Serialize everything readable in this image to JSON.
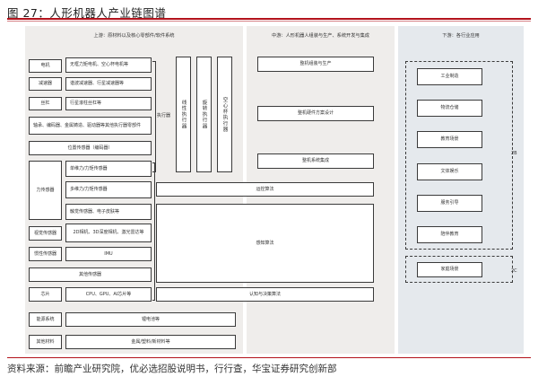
{
  "title": "图 27：人形机器人产业链图谱",
  "upstream": {
    "title": "上游：原材料以及核心零部件/软件系统",
    "rows": [
      {
        "category": "电机",
        "items": "无框力矩电机、空心杯电机等"
      },
      {
        "category": "减速器",
        "items": "谐波减速器、行星减速器等"
      },
      {
        "category": "丝杠",
        "items": "行星滚柱丝杠等"
      },
      {
        "category": "",
        "items": "轴承、编码器、金属铸造、驱动器等其他执行器零部件"
      },
      {
        "category": "",
        "items": "位置传感器（编码器）"
      }
    ],
    "sensor_rows": [
      {
        "category": "力传感器",
        "items": [
          "单维力/力矩传感器",
          "多维力/力矩传感器",
          "触觉传感器、电子皮肤等"
        ]
      },
      {
        "category": "视觉传感器",
        "items": [
          "2D相机、3D深度相机、激光雷达等"
        ]
      },
      {
        "category": "惯性传感器",
        "items": [
          "IMU"
        ]
      }
    ],
    "other_sensors": "其他传感器",
    "chip": {
      "category": "芯片",
      "items": "CPU、GPU、AI芯片等"
    },
    "energy": {
      "category": "能源系统",
      "items": "锂电池等"
    },
    "material": {
      "category": "其他材料",
      "items": "金属/塑料/新材料等"
    },
    "actuator_label": "执行器",
    "actuators": [
      "线性执行器",
      "旋转执行器",
      "空心杯执行器"
    ],
    "algorithms": [
      "运控算法",
      "感知算法",
      "认知与决策算法"
    ]
  },
  "midstream": {
    "title": "中游：人形机器人组装与生产、系统开发与集成",
    "items": [
      "整机组装与生产",
      "整机硬件方案设计",
      "整机系统集成"
    ]
  },
  "downstream": {
    "title": "下游：各行业应用",
    "items": [
      "工业制造",
      "物流仓储",
      "教育场景",
      "文体娱乐",
      "服务引导",
      "陪伴教育",
      "家庭场景"
    ],
    "tags": [
      "2B",
      "2C"
    ]
  },
  "footer": "资料来源：前瞻产业研究院，优必选招股说明书，行行查，华宝证券研究创新部"
}
